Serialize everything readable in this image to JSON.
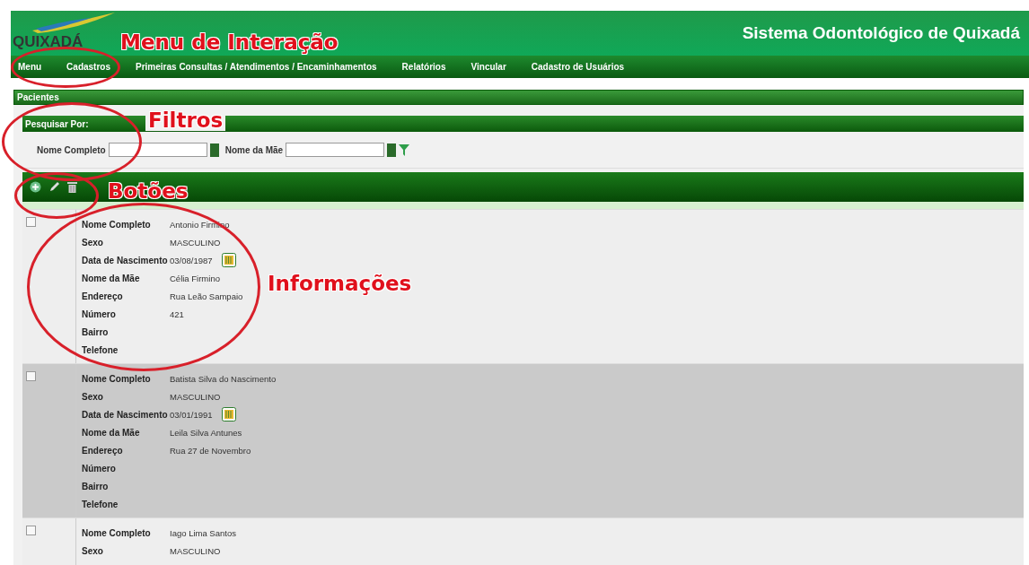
{
  "header": {
    "logo_text": "QUIXADÁ",
    "title": "Sistema Odontológico de Quixadá"
  },
  "nav": {
    "items": [
      "Menu",
      "Cadastros",
      "Primeiras Consultas / Atendimentos / Encaminhamentos",
      "Relatórios",
      "Vincular",
      "Cadastro de Usuários"
    ]
  },
  "section_title": "Pacientes",
  "filters": {
    "title": "Pesquisar Por:",
    "fields": [
      {
        "label": "Nome Completo"
      },
      {
        "label": "Nome da Mãe"
      }
    ]
  },
  "records": [
    {
      "checked": false,
      "fields": [
        {
          "kind": "text",
          "label": "Nome Completo",
          "value": "Antonio Firmino"
        },
        {
          "kind": "text",
          "label": "Sexo",
          "value": "MASCULINO"
        },
        {
          "kind": "date",
          "label": "Data de Nascimento",
          "value": "03/08/1987"
        },
        {
          "kind": "text",
          "label": "Nome da Mãe",
          "value": "Célia Firmino"
        },
        {
          "kind": "text",
          "label": "Endereço",
          "value": "Rua Leão Sampaio"
        },
        {
          "kind": "text",
          "label": "Número",
          "value": "421"
        },
        {
          "kind": "text",
          "label": "Bairro"
        },
        {
          "kind": "text",
          "label": "Telefone"
        }
      ]
    },
    {
      "checked": false,
      "fields": [
        {
          "kind": "text",
          "label": "Nome Completo",
          "value": "Batista Silva do Nascimento"
        },
        {
          "kind": "text",
          "label": "Sexo",
          "value": "MASCULINO"
        },
        {
          "kind": "date",
          "label": "Data de Nascimento",
          "value": "03/01/1991"
        },
        {
          "kind": "text",
          "label": "Nome da Mãe",
          "value": "Leila Silva Antunes"
        },
        {
          "kind": "text",
          "label": "Endereço",
          "value": "Rua 27 de Novembro"
        },
        {
          "kind": "text",
          "label": "Número"
        },
        {
          "kind": "text",
          "label": "Bairro"
        },
        {
          "kind": "text",
          "label": "Telefone"
        }
      ]
    },
    {
      "checked": false,
      "fields": [
        {
          "kind": "text",
          "label": "Nome Completo",
          "value": "Iago Lima Santos"
        },
        {
          "kind": "text",
          "label": "Sexo",
          "value": "MASCULINO"
        }
      ]
    }
  ],
  "annotations": [
    "Menu de Interação",
    "Filtros",
    "Botões",
    "Informações"
  ]
}
